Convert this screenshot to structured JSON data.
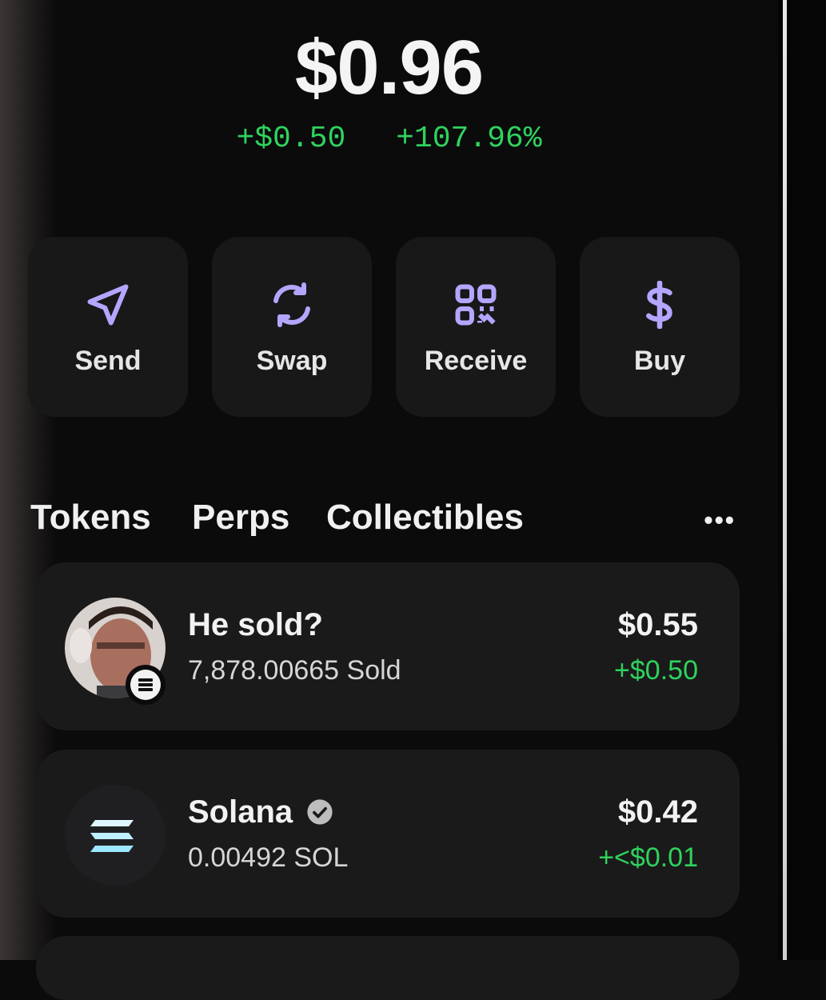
{
  "balance": {
    "total": "$0.96",
    "change_amount": "+$0.50",
    "change_percent": "+107.96%"
  },
  "actions": [
    {
      "label": "Send",
      "icon": "send-icon"
    },
    {
      "label": "Swap",
      "icon": "swap-icon"
    },
    {
      "label": "Receive",
      "icon": "qr-code-icon"
    },
    {
      "label": "Buy",
      "icon": "dollar-icon"
    }
  ],
  "tabs": {
    "tokens": "Tokens",
    "perps": "Perps",
    "collectibles": "Collectibles",
    "more": "•••"
  },
  "tokens": [
    {
      "name": "He sold?",
      "amount": "7,878.00665 Sold",
      "value": "$0.55",
      "change": "+$0.50"
    },
    {
      "name": "Solana",
      "amount": "0.00492 SOL",
      "value": "$0.42",
      "change": "+<$0.01"
    }
  ],
  "colors": {
    "accent_icon": "#b3a6ff",
    "positive": "#2fd35e",
    "card": "#1a1a1a",
    "background": "#0b0b0c"
  }
}
